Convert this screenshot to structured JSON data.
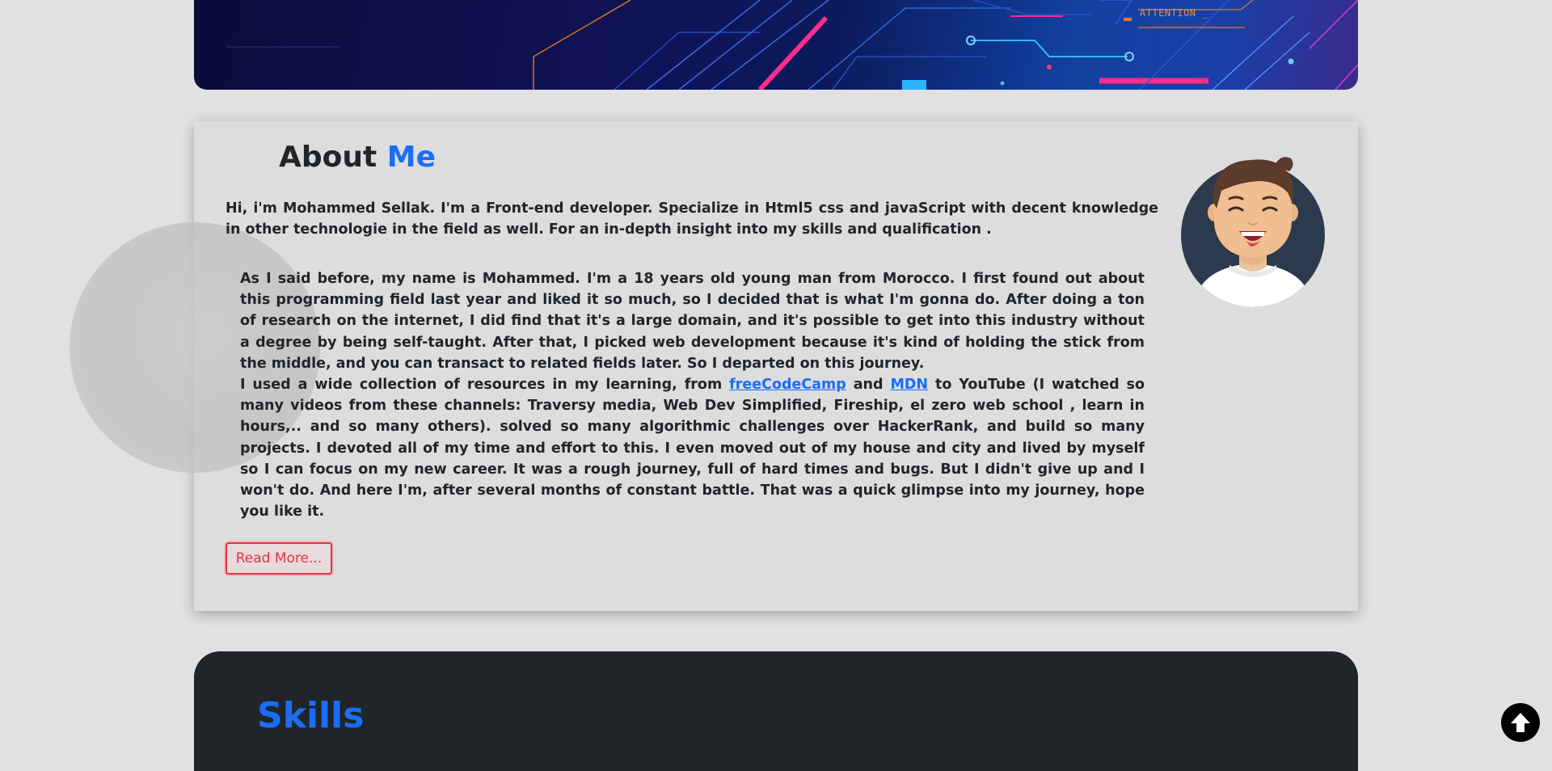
{
  "hero": {
    "badge_text": "ATTENTION _"
  },
  "about": {
    "title_prefix": "About",
    "title_accent": "Me",
    "intro": "Hi, i'm Mohammed Sellak. I'm a Front-end developer. Specialize in Html5 css and javaScript with decent knowledge in other technologie in the field as well. For an in-depth insight into my skills and qualification .",
    "story_p1": "As I said before, my name is Mohammed. I'm a 18 years old young man from Morocco. I first found out about this programming field last year and liked it so much, so I decided that is what I'm gonna do. After doing a ton of research on the internet, I did find that it's a large domain, and it's possible to get into this industry without a degree by being self-taught. After that, I picked web development because it's kind of holding the stick from the middle, and you can transact to related fields later. So I departed on this journey.",
    "story_p2_start": "I used a wide collection of resources in my learning, from ",
    "link_freecodecamp": "freeCodeCamp",
    "story_p2_and": " and ",
    "link_mdn": "MDN",
    "story_p2_end": " to YouTube (I watched so many videos from these channels: Traversy media, Web Dev Simplified, Fireship, el zero web school , learn in hours,.. and so many others). solved so many algorithmic challenges over HackerRank, and build so many projects. I devoted all of my time and effort to this. I even moved out of my house and city and lived by myself so I can focus on my new career. It was a rough journey, full of hard times and bugs. But I didn't give up and I won't do. And here I'm, after several months of constant battle. That was a quick glimpse into my journey, hope you like it.",
    "read_more_label": "Read More..."
  },
  "skills": {
    "title": "Skills"
  },
  "colors": {
    "accent": "#1a6ef5",
    "danger": "#dc3545",
    "dark": "#212529",
    "background": "#e1e1e1"
  },
  "icons": {
    "back_to_top": "arrow-up-circle-icon",
    "avatar": "smiling-man-avatar"
  }
}
